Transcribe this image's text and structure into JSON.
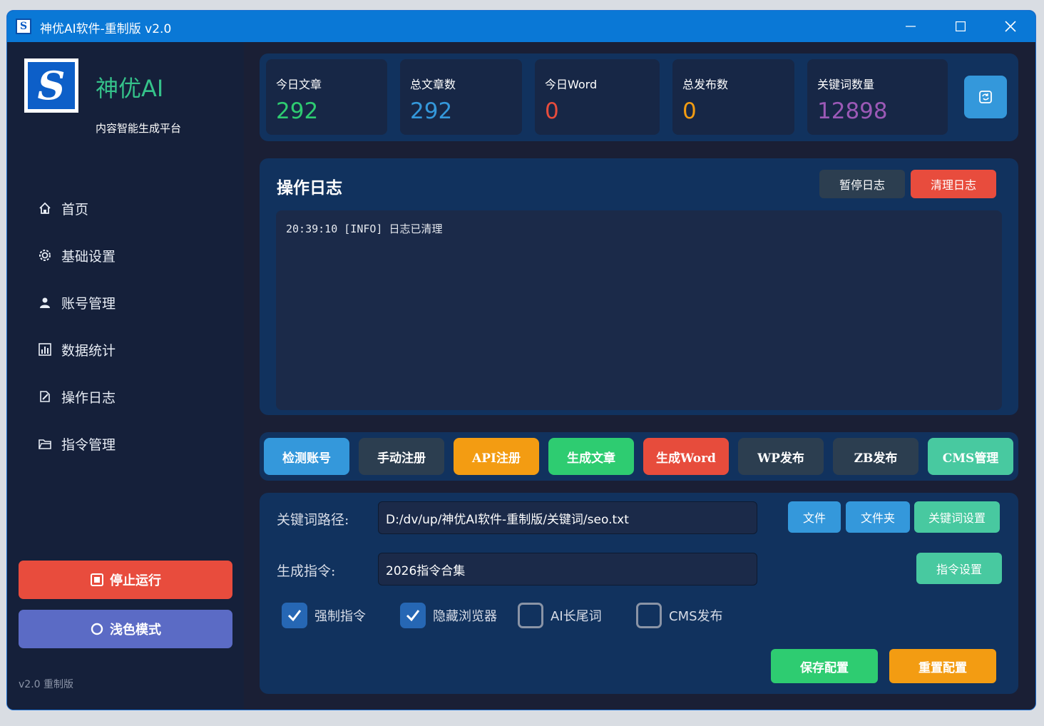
{
  "window": {
    "title": "神优AI软件-重制版 v2.0",
    "minimize": "—",
    "maximize": "☐",
    "close": "✕"
  },
  "sidebar": {
    "brand": "神优AI",
    "tagline": "内容智能生成平台",
    "items": [
      {
        "label": "首页",
        "icon": "home-icon"
      },
      {
        "label": "基础设置",
        "icon": "gear-icon"
      },
      {
        "label": "账号管理",
        "icon": "user-icon"
      },
      {
        "label": "数据统计",
        "icon": "chart-icon"
      },
      {
        "label": "操作日志",
        "icon": "edit-icon"
      },
      {
        "label": "指令管理",
        "icon": "folder-icon"
      }
    ],
    "stop_label": "停止运行",
    "light_label": "浅色模式",
    "version": "v2.0 重制版"
  },
  "stats": [
    {
      "label": "今日文章",
      "value": "292",
      "color": "#2ecc71"
    },
    {
      "label": "总文章数",
      "value": "292",
      "color": "#3498db"
    },
    {
      "label": "今日Word",
      "value": "0",
      "color": "#e74c3c"
    },
    {
      "label": "总发布数",
      "value": "0",
      "color": "#f39c12"
    },
    {
      "label": "关键词数量",
      "value": "12898",
      "color": "#9b59b6"
    }
  ],
  "log": {
    "title": "操作日志",
    "pause_label": "暂停日志",
    "clear_label": "清理日志",
    "entries": [
      "20:39:10 [INFO] 日志已清理"
    ]
  },
  "actions": [
    {
      "label": "检测账号",
      "color": "#3498db"
    },
    {
      "label": "手动注册",
      "color": "#2c3e50"
    },
    {
      "label": "API注册",
      "color": "#f39c12"
    },
    {
      "label": "生成文章",
      "color": "#2ecc71"
    },
    {
      "label": "生成Word",
      "color": "#e74c3c"
    },
    {
      "label": "WP发布",
      "color": "#2c3e50"
    },
    {
      "label": "ZB发布",
      "color": "#2c3e50"
    },
    {
      "label": "CMS管理",
      "color": "#48c9a0"
    }
  ],
  "config": {
    "keyword_path_label": "关键词路径:",
    "keyword_path_value": "D:/dv/up/神优AI软件-重制版/关键词/seo.txt",
    "file_label": "文件",
    "folder_label": "文件夹",
    "keyword_settings_label": "关键词设置",
    "command_label": "生成指令:",
    "command_value": "2026指令合集",
    "command_settings_label": "指令设置",
    "checkboxes": [
      {
        "label": "强制指令",
        "checked": true
      },
      {
        "label": "隐藏浏览器",
        "checked": true
      },
      {
        "label": "AI长尾词",
        "checked": false
      },
      {
        "label": "CMS发布",
        "checked": false
      }
    ],
    "save_label": "保存配置",
    "reset_label": "重置配置"
  }
}
